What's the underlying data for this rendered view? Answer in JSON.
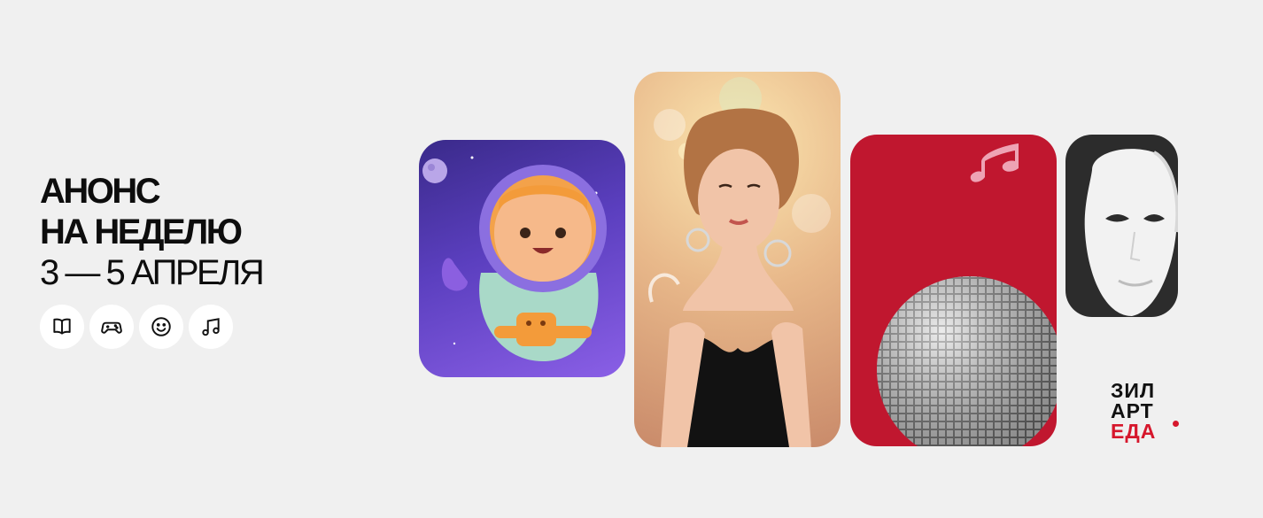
{
  "heading": {
    "line1": "АНОНС",
    "line2": "НА НЕДЕЛЮ",
    "line3": "3 — 5 АПРЕЛЯ"
  },
  "categories": [
    {
      "icon": "book-icon"
    },
    {
      "icon": "gamepad-icon"
    },
    {
      "icon": "smiley-icon"
    },
    {
      "icon": "music-note-icon"
    }
  ],
  "cards": [
    {
      "icon": "astronaut-illustration",
      "color": "#5b3fbf"
    },
    {
      "icon": "singer-photo",
      "color": "#e8b88a"
    },
    {
      "icon": "disco-ball-image",
      "color": "#c0172f"
    },
    {
      "icon": "theater-mask-image",
      "color": "#2c2c2c"
    }
  ],
  "logo": {
    "line1": "ЗИЛ",
    "line2": "АРТ",
    "line3": "ЕДА",
    "accent_color": "#d6172c"
  }
}
